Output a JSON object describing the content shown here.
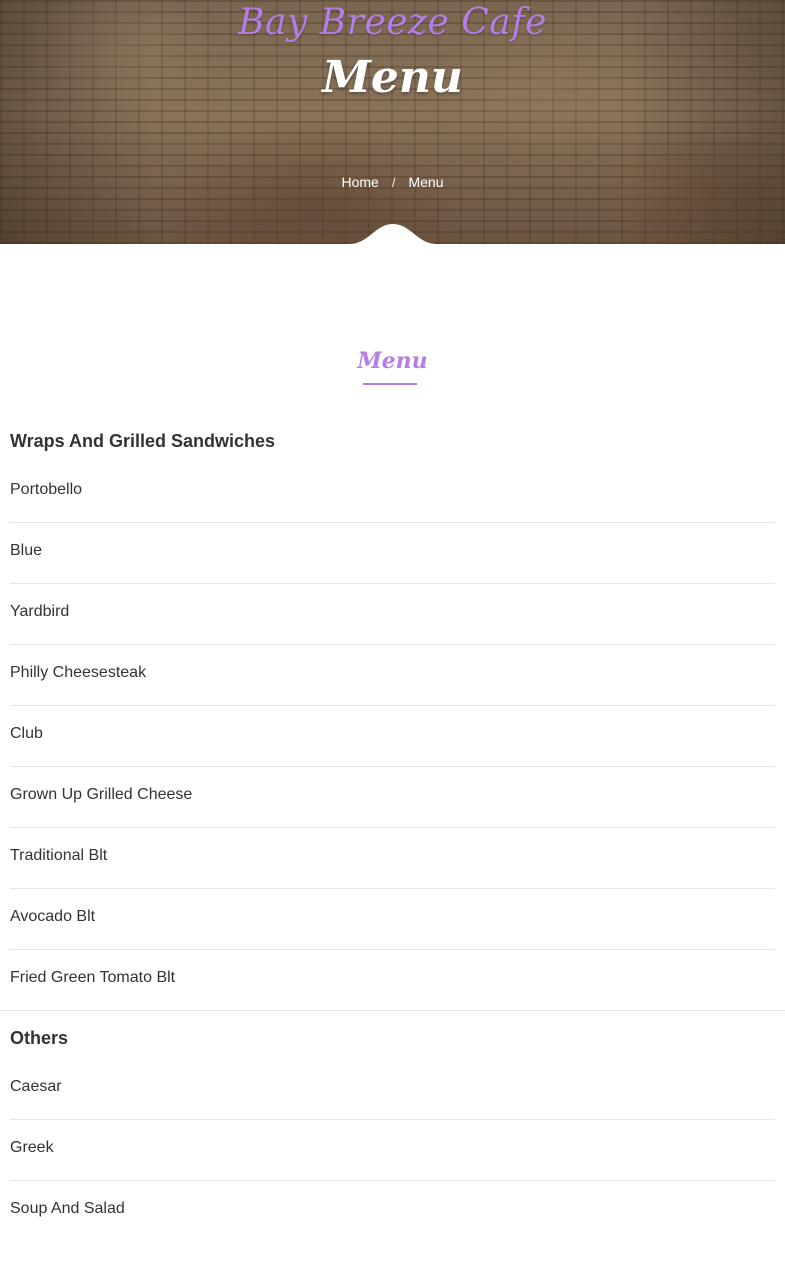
{
  "header": {
    "brand": "Bay Breeze Cafe",
    "page_title": "Menu",
    "breadcrumb": {
      "home": "Home",
      "separator": "/",
      "current": "Menu"
    }
  },
  "section": {
    "title": "Menu"
  },
  "categories": [
    {
      "heading": "Wraps And Grilled Sandwiches",
      "items": [
        "Portobello",
        "Blue",
        "Yardbird",
        "Philly Cheesesteak",
        "Club",
        "Grown Up Grilled Cheese",
        "Traditional Blt",
        "Avocado Blt",
        "Fried Green Tomato Blt"
      ]
    },
    {
      "heading": "Others",
      "items": [
        "Caesar",
        "Greek",
        "Soup And Salad"
      ]
    }
  ],
  "colors": {
    "accent": "#b57ee6",
    "text": "#333333",
    "divider": "#e6e6e6"
  }
}
